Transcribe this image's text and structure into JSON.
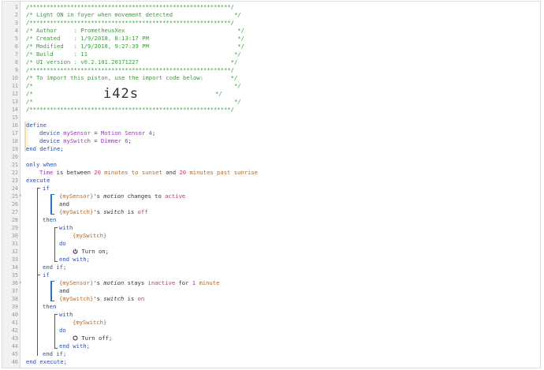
{
  "editor": {
    "line_numbers": [
      "1",
      "2",
      "3",
      "4",
      "5",
      "6",
      "7",
      "8",
      "9",
      "10",
      "11",
      "12",
      "13",
      "14",
      "15",
      "16",
      "17",
      "18",
      "19",
      "20",
      "21",
      "22",
      "23",
      "24",
      "25",
      "26",
      "27",
      "28",
      "29",
      "30",
      "31",
      "32",
      "33",
      "34",
      "35",
      "36",
      "37",
      "38",
      "39",
      "40",
      "41",
      "42",
      "43",
      "44",
      "45",
      "46"
    ],
    "markers": {
      "25": "⚡",
      "36": "⚡"
    }
  },
  "header": {
    "border": "/***********************************************************/",
    "title": "/* Light ON in foyer when movement detected                  */",
    "author": "/* Author     : PrometheusXex                                 */",
    "created": "/* Created    : 1/9/2018, 8:13:17 PM                          */",
    "modified": "/* Modified   : 1/9/2018, 9:27:39 PM                          */",
    "build": "/* Build      : 11                                           */",
    "ui_version": "/* UI version : v0.2.101.20171227                           */",
    "import_line": "/* To import this piston, use the import code below:        */",
    "blank": "/*                                                           */",
    "code_prefix": "/*",
    "import_code": "i42s",
    "code_suffix": "*/"
  },
  "code": {
    "define": "define",
    "device_kw": "device",
    "sensor_var": "mySensor",
    "eq": "=",
    "sensor_val": "Motion Sensor 4",
    "switch_var": "mySwitch",
    "switch_val": "Dimmer 6",
    "semi": ";",
    "end_define": "end define;",
    "only_when": "only when",
    "time": "Time",
    "is_between": "is between",
    "twenty": "20",
    "minutes_to": "minutes to",
    "sunset": "sunset",
    "and": "and",
    "minutes_past": "minutes past",
    "sunrise": "sunrise",
    "execute": "execute",
    "if": "if",
    "sensor_ref": "{mySensor}",
    "switch_ref": "{mySwitch}",
    "apos_s": "'s",
    "motion": "motion",
    "changes_to": "changes to",
    "active": "active",
    "switch_word": "switch",
    "is": "is",
    "off": "off",
    "then": "then",
    "with": "with",
    "do": "do",
    "turn_on": "Turn on;",
    "end_with": "end with;",
    "end_if": "end if;",
    "stays": "stays",
    "inactive": "inactive",
    "for": "for",
    "one": "1",
    "minute": "minute",
    "on": "on",
    "turn_off": "Turn off;",
    "end_execute": "end execute;"
  },
  "colors": {
    "comment": "#3c9a3c",
    "keyword": "#2a4fb5",
    "string": "#b36a2e",
    "variable": "#9b3cb6",
    "number": "#b0407a"
  }
}
